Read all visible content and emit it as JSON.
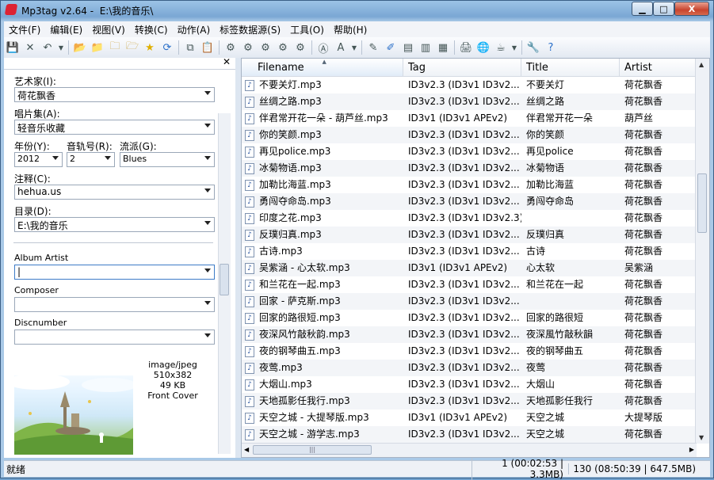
{
  "window": {
    "app_title": "Mp3tag v2.64",
    "path_title": "E:\\我的音乐\\",
    "caption": {
      "minimize": "▁",
      "maximize": "□",
      "close": "X"
    }
  },
  "menu": [
    "文件(F)",
    "编辑(E)",
    "视图(V)",
    "转换(C)",
    "动作(A)",
    "标签数据源(S)",
    "工具(O)",
    "帮助(H)"
  ],
  "left": {
    "artist_label": "艺术家(I):",
    "artist_value": "荷花飘香",
    "album_label": "唱片集(A):",
    "album_value": "轻音乐收藏",
    "year_label": "年份(Y):",
    "year_value": "2012",
    "track_label": "音轨号(R):",
    "track_value": "2",
    "genre_label": "流派(G):",
    "genre_value": "Blues",
    "comment_label": "注释(C):",
    "comment_value": "hehua.us",
    "directory_label": "目录(D):",
    "directory_value": "E:\\我的音乐",
    "album_artist_label": "Album Artist",
    "album_artist_value": "|",
    "composer_label": "Composer",
    "composer_value": "",
    "discnumber_label": "Discnumber",
    "discnumber_value": "",
    "cover": {
      "mime": "image/jpeg",
      "dims": "510x382",
      "size": "49 KB",
      "type": "Front Cover"
    }
  },
  "columns": [
    "Filename",
    "Tag",
    "Title",
    "Artist"
  ],
  "rows": [
    {
      "filename": "不要关灯.mp3",
      "tag": "ID3v2.3 (ID3v1 ID3v2...",
      "title": "不要关灯",
      "artist": "荷花飘香"
    },
    {
      "filename": "丝绸之路.mp3",
      "tag": "ID3v2.3 (ID3v1 ID3v2...",
      "title": "丝绸之路",
      "artist": "荷花飘香"
    },
    {
      "filename": "伴君常开花一朵 - 葫芦丝.mp3",
      "tag": "ID3v1 (ID3v1 APEv2)",
      "title": "伴君常开花一朵",
      "artist": "葫芦丝"
    },
    {
      "filename": "你的笑颜.mp3",
      "tag": "ID3v2.3 (ID3v1 ID3v2...",
      "title": "你的笑颜",
      "artist": "荷花飘香"
    },
    {
      "filename": "再见police.mp3",
      "tag": "ID3v2.3 (ID3v1 ID3v2...",
      "title": "再见police",
      "artist": "荷花飘香"
    },
    {
      "filename": "冰菊物语.mp3",
      "tag": "ID3v2.3 (ID3v1 ID3v2...",
      "title": "冰菊物语",
      "artist": "荷花飘香"
    },
    {
      "filename": "加勒比海蓝.mp3",
      "tag": "ID3v2.3 (ID3v1 ID3v2...",
      "title": "加勒比海蓝",
      "artist": "荷花飘香"
    },
    {
      "filename": "勇闯夺命岛.mp3",
      "tag": "ID3v2.3 (ID3v1 ID3v2...",
      "title": "勇闯夺命岛",
      "artist": "荷花飘香"
    },
    {
      "filename": "印度之花.mp3",
      "tag": "ID3v2.3 (ID3v1 ID3v2.3)",
      "title": "",
      "artist": "荷花飘香"
    },
    {
      "filename": "反璞归真.mp3",
      "tag": "ID3v2.3 (ID3v1 ID3v2...",
      "title": "反璞归真",
      "artist": "荷花飘香"
    },
    {
      "filename": "古诗.mp3",
      "tag": "ID3v2.3 (ID3v1 ID3v2...",
      "title": "古诗",
      "artist": "荷花飘香"
    },
    {
      "filename": "吴紫涵 - 心太软.mp3",
      "tag": "ID3v1 (ID3v1 APEv2)",
      "title": "心太软",
      "artist": "吴紫涵"
    },
    {
      "filename": "和兰花在一起.mp3",
      "tag": "ID3v2.3 (ID3v1 ID3v2...",
      "title": "和兰花在一起",
      "artist": "荷花飘香"
    },
    {
      "filename": "回家 - 萨克斯.mp3",
      "tag": "ID3v2.3 (ID3v1 ID3v2...",
      "title": "",
      "artist": "荷花飘香"
    },
    {
      "filename": "回家的路很短.mp3",
      "tag": "ID3v2.3 (ID3v1 ID3v2...",
      "title": "回家的路很短",
      "artist": "荷花飘香"
    },
    {
      "filename": "夜深风竹敲秋韵.mp3",
      "tag": "ID3v2.3 (ID3v1 ID3v2...",
      "title": "夜深風竹敲秋韻",
      "artist": "荷花飘香"
    },
    {
      "filename": "夜的钢琴曲五.mp3",
      "tag": "ID3v2.3 (ID3v1 ID3v2...",
      "title": "夜的钢琴曲五",
      "artist": "荷花飘香"
    },
    {
      "filename": "夜莺.mp3",
      "tag": "ID3v2.3 (ID3v1 ID3v2...",
      "title": "夜莺",
      "artist": "荷花飘香"
    },
    {
      "filename": "大烟山.mp3",
      "tag": "ID3v2.3 (ID3v1 ID3v2...",
      "title": "大烟山",
      "artist": "荷花飘香"
    },
    {
      "filename": "天地孤影任我行.mp3",
      "tag": "ID3v2.3 (ID3v1 ID3v2...",
      "title": "天地孤影任我行",
      "artist": "荷花飘香"
    },
    {
      "filename": "天空之城 - 大提琴版.mp3",
      "tag": "ID3v1 (ID3v1 APEv2)",
      "title": "天空之城",
      "artist": "大提琴版"
    },
    {
      "filename": "天空之城 - 游学志.mp3",
      "tag": "ID3v2.3 (ID3v1 ID3v2...",
      "title": "天空之城",
      "artist": "荷花飘香"
    }
  ],
  "status": {
    "ready": "就绪",
    "selection": "1 (00:02:53 | 3.3MB)",
    "total": "130 (08:50:39 | 647.5MB)"
  }
}
